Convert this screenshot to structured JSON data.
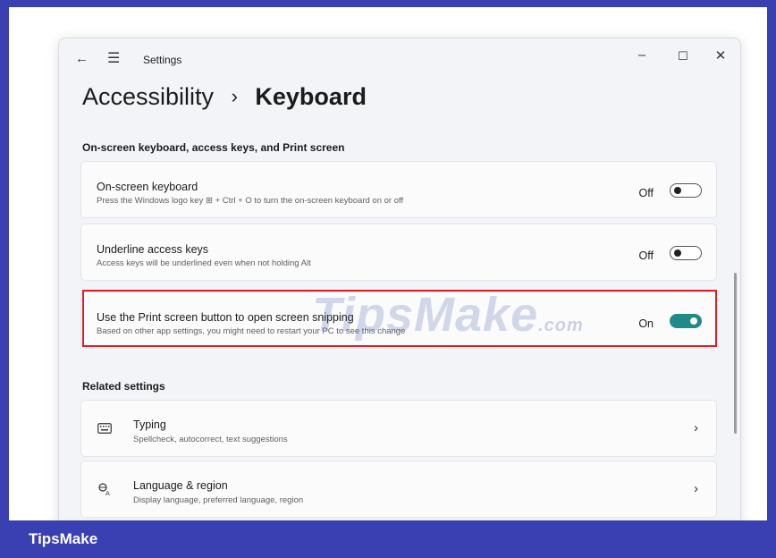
{
  "window": {
    "app_title": "Settings",
    "back_icon": "arrow-left-icon",
    "menu_icon": "hamburger-icon",
    "controls": [
      "minimize",
      "maximize",
      "close"
    ]
  },
  "breadcrumb": {
    "parent": "Accessibility",
    "separator": "›",
    "current": "Keyboard"
  },
  "section1": {
    "title": "On-screen keyboard, access keys, and Print screen",
    "items": [
      {
        "title": "On-screen keyboard",
        "subtitle": "Press the Windows logo key ⊞ + Ctrl + O to turn the on-screen keyboard on or off",
        "state": "Off",
        "enabled": false
      },
      {
        "title": "Underline access keys",
        "subtitle": "Access keys will be underlined even when not holding Alt",
        "state": "Off",
        "enabled": false
      },
      {
        "title": "Use the Print screen button to open screen snipping",
        "subtitle": "Based on other app settings, you might need to restart your PC to see this change",
        "state": "On",
        "enabled": true,
        "highlighted": true
      }
    ]
  },
  "section2": {
    "title": "Related settings",
    "items": [
      {
        "icon": "keyboard-icon",
        "title": "Typing",
        "subtitle": "Spellcheck, autocorrect, text suggestions"
      },
      {
        "icon": "language-icon",
        "title": "Language & region",
        "subtitle": "Display language, preferred language, region"
      }
    ]
  },
  "watermark": {
    "text": "TipsMake",
    "suffix": ".com"
  },
  "footer": {
    "brand": "TipsMake"
  },
  "colors": {
    "accent_toggle": "#1f8a8a",
    "highlight_border": "#d9202a",
    "frame": "#3a3fb2"
  }
}
